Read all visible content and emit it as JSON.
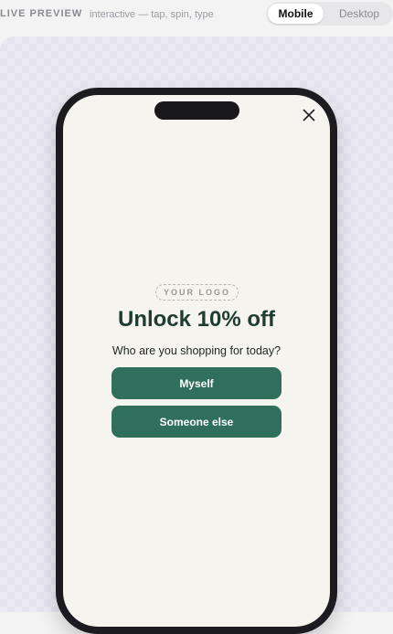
{
  "header": {
    "live_label": "LIVE PREVIEW",
    "sub_label": "interactive — tap, spin, type",
    "view_toggle": {
      "options": [
        "Mobile",
        "Desktop"
      ],
      "selected": "Mobile"
    }
  },
  "popup": {
    "logo_text": "YOUR LOGO",
    "headline": "Unlock 10% off",
    "question": "Who are you shopping for today?",
    "choices": [
      "Myself",
      "Someone else"
    ],
    "close_icon": "close-icon"
  },
  "colors": {
    "brand_green": "#2f6f5b",
    "headline_green": "#1f3c32",
    "screen_bg": "#f6f4ef",
    "phone_frame": "#1c1c20"
  }
}
